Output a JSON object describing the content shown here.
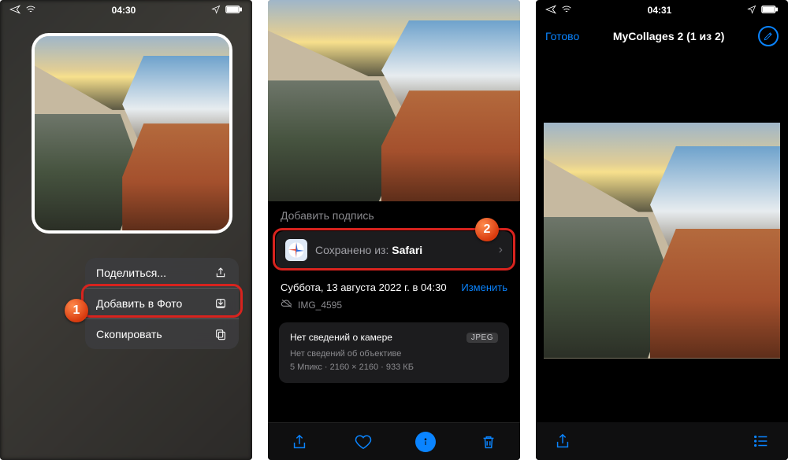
{
  "screen1": {
    "status_time": "04:30",
    "menu": {
      "share": "Поделиться...",
      "add_to_photos": "Добавить в Фото",
      "copy": "Скопировать"
    },
    "badge": "1"
  },
  "screen2": {
    "caption_placeholder": "Добавить подпись",
    "saved_from_prefix": "Сохранено из: ",
    "saved_from_app": "Safari",
    "date": "Суббота, 13 августа 2022 г. в 04:30",
    "edit": "Изменить",
    "filename": "IMG_4595",
    "camera_info_title": "Нет сведений о камере",
    "format_badge": "JPEG",
    "lens_info": "Нет сведений об объективе",
    "meta_line": "5 Мпикс · 2160 × 2160 · 933 КБ",
    "badge": "2"
  },
  "screen3": {
    "status_time": "04:31",
    "done": "Готово",
    "title": "MyCollages 2 (1 из 2)"
  }
}
